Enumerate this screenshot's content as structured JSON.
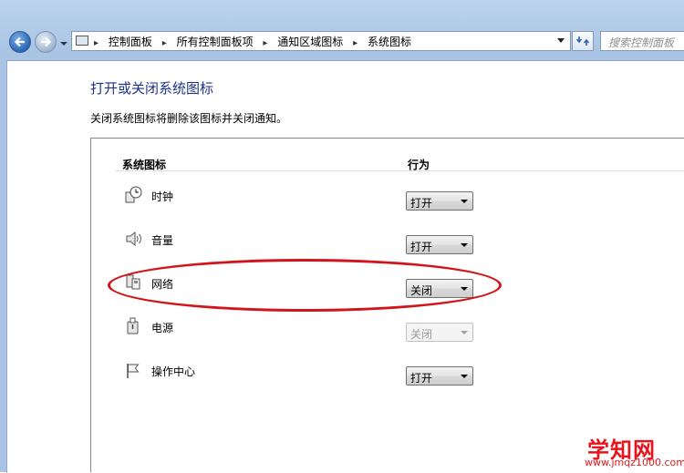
{
  "window": {
    "frame_color": "#a9c4e4"
  },
  "address_bar": {
    "breadcrumbs": [
      "控制面板",
      "所有控制面板项",
      "通知区域图标",
      "系统图标"
    ],
    "separator": "▸"
  },
  "search": {
    "placeholder": "搜索控制面板"
  },
  "page": {
    "title": "打开或关闭系统图标",
    "description": "关闭系统图标将删除该图标并关闭通知。"
  },
  "table": {
    "col_icon": "系统图标",
    "col_behavior": "行为",
    "rows": [
      {
        "icon": "clock-icon",
        "label": "时钟",
        "value": "打开",
        "enabled": true
      },
      {
        "icon": "volume-icon",
        "label": "音量",
        "value": "打开",
        "enabled": true
      },
      {
        "icon": "network-icon",
        "label": "网络",
        "value": "关闭",
        "enabled": true,
        "highlighted": true
      },
      {
        "icon": "power-icon",
        "label": "电源",
        "value": "关闭",
        "enabled": false
      },
      {
        "icon": "flag-icon",
        "label": "操作中心",
        "value": "打开",
        "enabled": true
      }
    ]
  },
  "highlight_color": "#d2151b",
  "watermark": {
    "text": "学知网",
    "url": "www.jmqz1000.com"
  }
}
